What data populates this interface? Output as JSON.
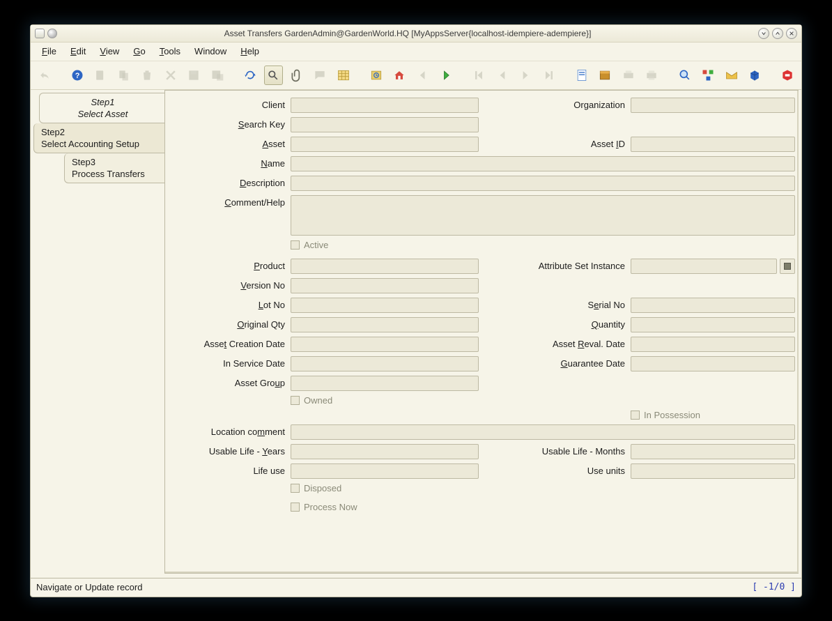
{
  "window": {
    "title": "Asset Transfers  GardenAdmin@GardenWorld.HQ [MyAppsServer{localhost-idempiere-adempiere}]"
  },
  "menu": {
    "file": "File",
    "edit": "Edit",
    "view": "View",
    "go": "Go",
    "tools": "Tools",
    "window": "Window",
    "help": "Help"
  },
  "steps": {
    "s1a": "Step1",
    "s1b": "Select Asset",
    "s2a": "Step2",
    "s2b": "Select Accounting Setup",
    "s3a": "Step3",
    "s3b": "Process Transfers"
  },
  "labels": {
    "client": "Client",
    "organization": "Organization",
    "search_key": "Search Key",
    "asset": "Asset",
    "asset_id": "Asset ID",
    "name": "Name",
    "description": "Description",
    "comment": "Comment/Help",
    "active": "Active",
    "product": "Product",
    "attr": "Attribute Set Instance",
    "version": "Version No",
    "lot": "Lot No",
    "serial": "Serial No",
    "origqty": "Original Qty",
    "quantity": "Quantity",
    "creation": "Asset Creation Date",
    "reval": "Asset Reval. Date",
    "inservice": "In Service Date",
    "guarantee": "Guarantee Date",
    "group": "Asset Group",
    "owned": "Owned",
    "possession": "In Possession",
    "loc_comment": "Location comment",
    "ul_years": "Usable Life - Years",
    "ul_months": "Usable Life - Months",
    "life_use": "Life use",
    "use_units": "Use units",
    "disposed": "Disposed",
    "process_now": "Process Now"
  },
  "status": {
    "msg": "Navigate or Update record",
    "rec": "[  -1/0 ]"
  },
  "values": {
    "client": "",
    "organization": "",
    "search_key": "",
    "asset": "",
    "asset_id": "",
    "name": "",
    "description": "",
    "comment": "",
    "product": "",
    "attr": "",
    "version": "",
    "lot": "",
    "serial": "",
    "origqty": "",
    "quantity": "",
    "creation": "",
    "reval": "",
    "inservice": "",
    "guarantee": "",
    "group": "",
    "loc_comment": "",
    "ul_years": "",
    "ul_months": "",
    "life_use": "",
    "use_units": ""
  }
}
